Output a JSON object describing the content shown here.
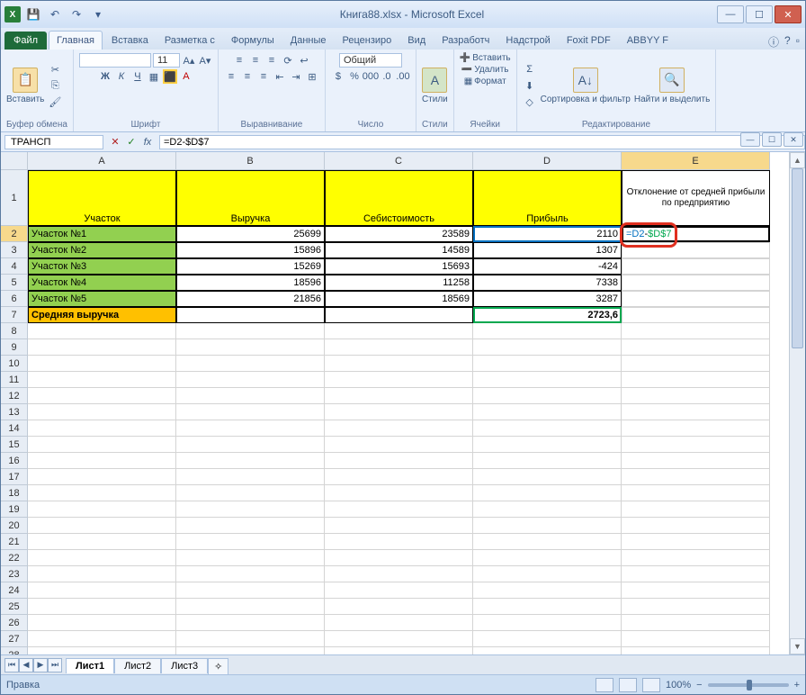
{
  "title": "Книга88.xlsx - Microsoft Excel",
  "tabs": {
    "file": "Файл",
    "home": "Главная",
    "insert": "Вставка",
    "layout": "Разметка с",
    "formulas": "Формулы",
    "data": "Данные",
    "review": "Рецензиро",
    "view": "Вид",
    "developer": "Разработч",
    "addins": "Надстрой",
    "foxit": "Foxit PDF",
    "abbyy": "ABBYY F"
  },
  "ribbon": {
    "paste": "Вставить",
    "clipboard": "Буфер обмена",
    "font_group": "Шрифт",
    "align_group": "Выравнивание",
    "number_group": "Число",
    "styles_group": "Стили",
    "cells_group": "Ячейки",
    "editing_group": "Редактирование",
    "styles": "Стили",
    "format": "Общий",
    "insert_cell": "Вставить",
    "delete_cell": "Удалить",
    "format_cell": "Формат",
    "sort": "Сортировка и фильтр",
    "find": "Найти и выделить",
    "font_size": "11"
  },
  "namebox": "ТРАНСП",
  "formula": "=D2-$D$7",
  "cols": [
    "A",
    "B",
    "C",
    "D",
    "E"
  ],
  "headers": {
    "A": "Участок",
    "B": "Выручка",
    "C": "Себистоимость",
    "D": "Прибыль",
    "E": "Отклонение от средней прибыли по предприятию"
  },
  "rows": [
    {
      "a": "Участок №1",
      "b": "25699",
      "c": "23589",
      "d": "2110"
    },
    {
      "a": "Участок №2",
      "b": "15896",
      "c": "14589",
      "d": "1307"
    },
    {
      "a": "Участок №3",
      "b": "15269",
      "c": "15693",
      "d": "-424"
    },
    {
      "a": "Участок №4",
      "b": "18596",
      "c": "11258",
      "d": "7338"
    },
    {
      "a": "Участок №5",
      "b": "21856",
      "c": "18569",
      "d": "3287"
    }
  ],
  "avg_label": "Средняя выручка",
  "avg_val": "2723,6",
  "edit_cell": {
    "pre": "=D2",
    "mid": "-",
    "ref": "$D$7"
  },
  "sheets": {
    "s1": "Лист1",
    "s2": "Лист2",
    "s3": "Лист3"
  },
  "status": "Правка",
  "zoom": "100%"
}
